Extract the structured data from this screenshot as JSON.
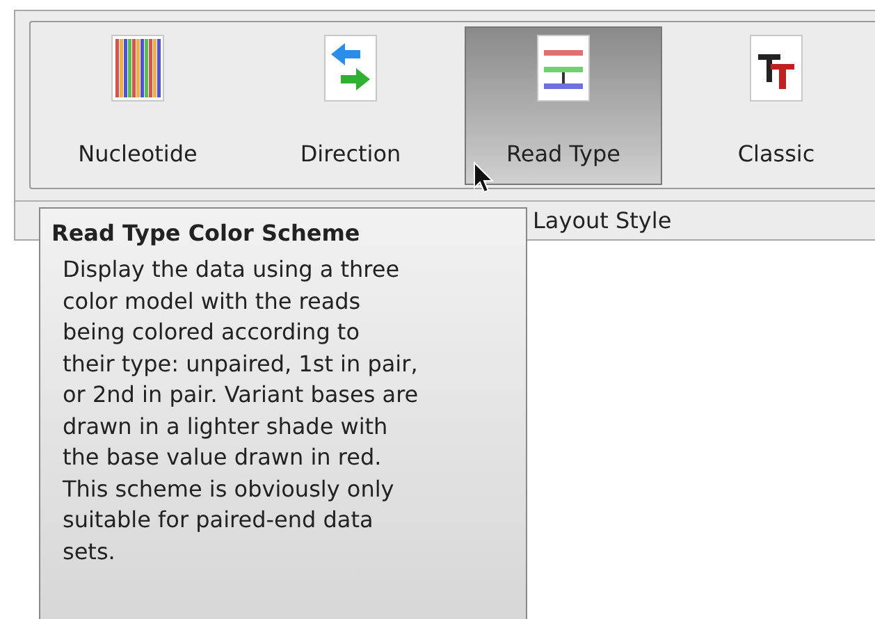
{
  "toolbar": {
    "buttons": [
      {
        "label": "Nucleotide",
        "kind": "nucleotide",
        "selected": false
      },
      {
        "label": "Direction",
        "kind": "direction",
        "selected": false
      },
      {
        "label": "Read Type",
        "kind": "readtype",
        "selected": true
      },
      {
        "label": "Classic",
        "kind": "classic",
        "selected": false
      }
    ],
    "group_label": "Layout Style"
  },
  "tooltip": {
    "title": "Read Type Color Scheme",
    "body": "Display the data using a three\ncolor model with the reads\nbeing colored according to\ntheir type: unpaired, 1st in pair,\nor 2nd in pair. Variant bases are\ndrawn in a lighter shade with\nthe base value drawn in red.\nThis scheme is obviously only\nsuitable for paired-end data\nsets."
  }
}
